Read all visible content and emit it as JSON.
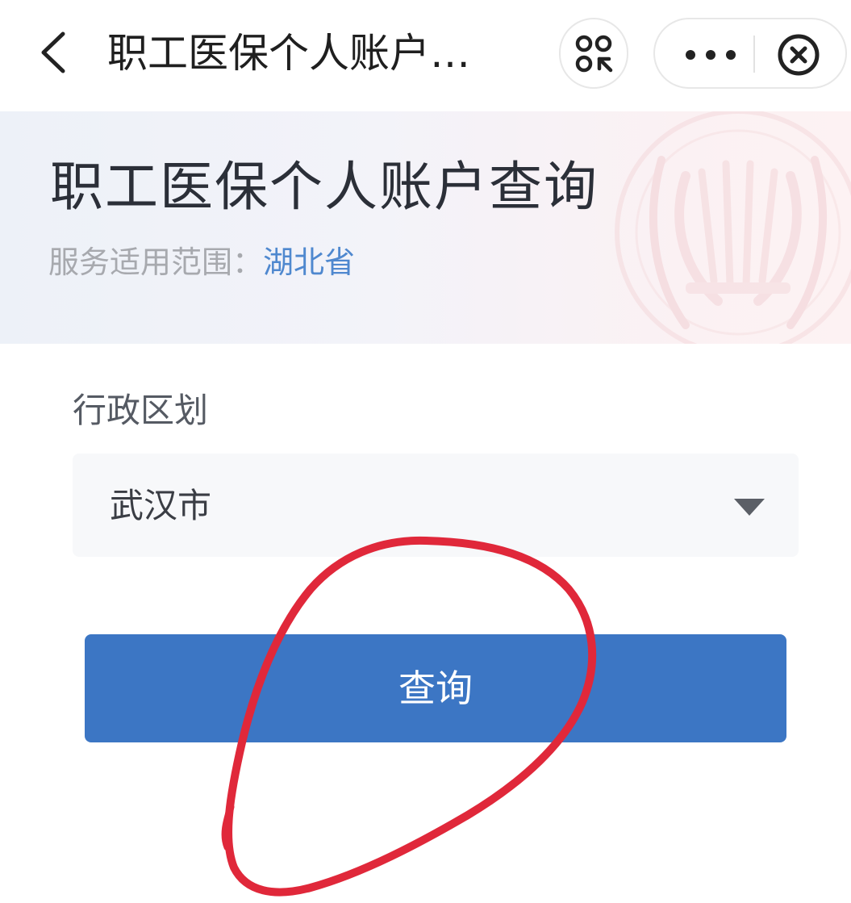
{
  "navbar": {
    "title": "职工医保个人账户…",
    "back_icon": "chevron-left-icon",
    "qr_icon": "scan-code-icon",
    "more_icon": "more-dots-icon",
    "close_icon": "close-circle-icon"
  },
  "header": {
    "title": "职工医保个人账户查询",
    "scope_label": "服务适用范围：",
    "scope_value": "湖北省"
  },
  "form": {
    "region_label": "行政区划",
    "region_value": "武汉市",
    "submit_label": "查询"
  },
  "colors": {
    "primary_button": "#3c76c4",
    "scope_value": "#4f88cf",
    "annotation": "#e0283a"
  }
}
